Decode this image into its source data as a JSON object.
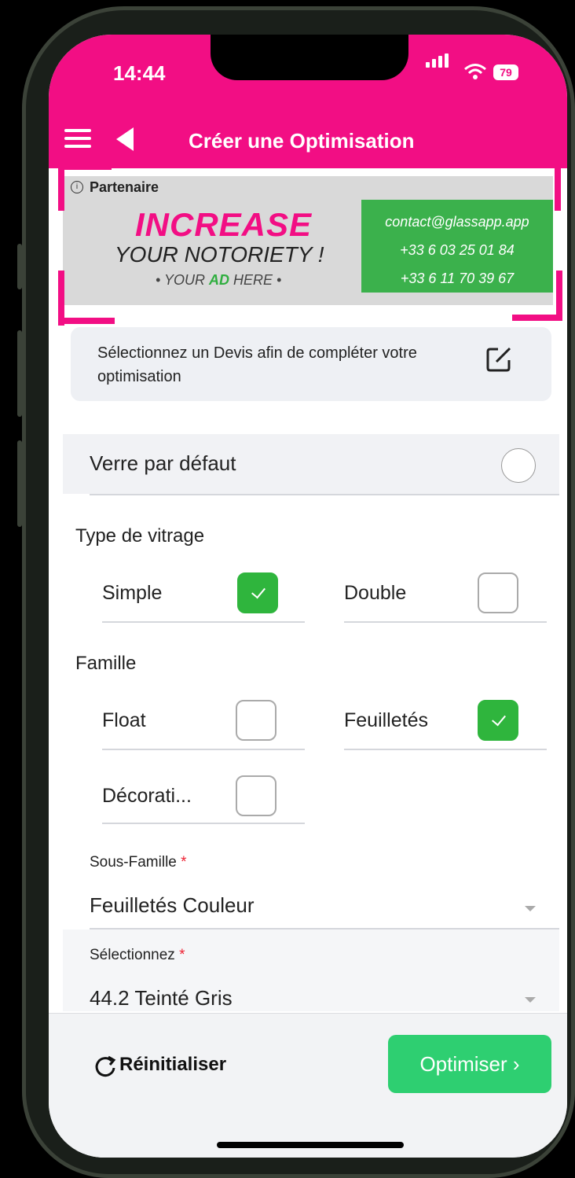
{
  "status_bar": {
    "time": "14:44",
    "battery": "79"
  },
  "header": {
    "title": "Créer une Optimisation"
  },
  "ad": {
    "partner_label": "Partenaire",
    "headline": "INCREASE",
    "subline": "YOUR NOTORIETY !",
    "placeholder_prefix": "• YOUR ",
    "placeholder_highlight": "AD",
    "placeholder_suffix": " HERE •",
    "contact_email": "contact@glassapp.app",
    "phone_1": "+33 6 03 25 01 84",
    "phone_2": "+33 6 11 70 39 67"
  },
  "devis": {
    "text": "Sélectionnez un Devis afin de compléter votre optimisation"
  },
  "default_glass": {
    "label": "Verre par défaut",
    "checked": false
  },
  "vitrage": {
    "section_label": "Type de vitrage",
    "options": [
      {
        "label": "Simple",
        "checked": true
      },
      {
        "label": "Double",
        "checked": false
      }
    ]
  },
  "famille": {
    "section_label": "Famille",
    "options": [
      {
        "label": "Float",
        "checked": false
      },
      {
        "label": "Feuilletés",
        "checked": true
      },
      {
        "label": "Décorati...",
        "checked": false
      }
    ]
  },
  "sous_famille": {
    "label": "Sous-Famille",
    "required_mark": "*",
    "value": "Feuilletés Couleur"
  },
  "selection": {
    "label": "Sélectionnez",
    "required_mark": "*",
    "value": "44.2 Teinté Gris"
  },
  "footer": {
    "reset_label": "Réinitialiser",
    "optimize_label": "Optimiser ›"
  },
  "colors": {
    "brand": "#f20e84",
    "accent_green": "#2fb53d",
    "button_green": "#2ecf71"
  }
}
